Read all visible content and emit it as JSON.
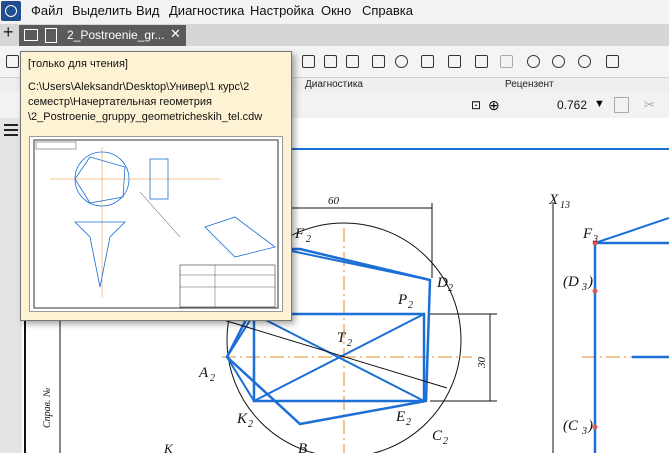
{
  "menu": {
    "items": [
      "Файл",
      "Выделить",
      "Вид",
      "Диагностика",
      "Настройка",
      "Окно",
      "Справка"
    ]
  },
  "tabs": {
    "add_label": "+",
    "document_title": "2_Postroenie_gr...",
    "close_label": "✕"
  },
  "sections": {
    "diagnostics": "Диагностика",
    "reviewer": "Рецензент"
  },
  "zoom": {
    "value": "0.762"
  },
  "tooltip": {
    "readonly": "[только для чтения]",
    "path_line1": "C:\\Users\\Aleksandr\\Desktop\\Универ\\1 курс\\2",
    "path_line2": "семестр\\Начертательная геометрия",
    "path_line3": "\\2_Postroenie_gruppy_geometricheskih_tel.cdw"
  },
  "drawing": {
    "dim_60": "60",
    "dim_30": "30",
    "label_F2": "F",
    "label_D2": "D",
    "label_P2": "P",
    "label_T2": "T",
    "label_A2": "A",
    "label_K2": "K",
    "label_E2": "E",
    "label_C2": "C",
    "label_B2": "B",
    "label_X13": "X",
    "label_F3": "F",
    "label_D3": "(D",
    "label_C3": "(C",
    "sub_2": "2",
    "sub_3": "3",
    "sub_13": "13",
    "close_paren": ")",
    "side_stamp": "Справ. №",
    "frag_K": "K"
  },
  "colors": {
    "accent_blue": "#1b6fd6",
    "axis_orange": "#e08a2a",
    "tooltip_bg": "#fdf3d4",
    "tab_dark": "#5b5b5b"
  }
}
